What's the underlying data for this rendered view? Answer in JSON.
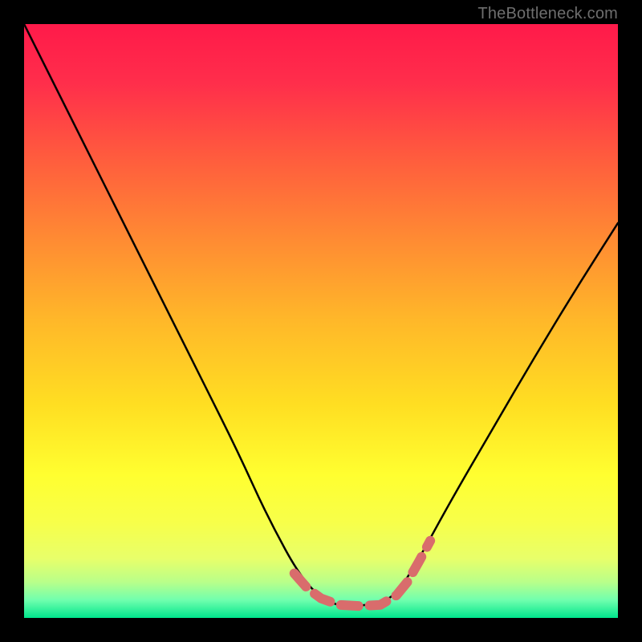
{
  "attribution": "TheBottleneck.com",
  "colors": {
    "frame": "#000000",
    "curve": "#000000",
    "rope": "#d96c6c",
    "gradient_stops": [
      {
        "offset": 0.0,
        "color": "#ff1a4a"
      },
      {
        "offset": 0.1,
        "color": "#ff2e4b"
      },
      {
        "offset": 0.22,
        "color": "#ff5a3e"
      },
      {
        "offset": 0.36,
        "color": "#ff8a33"
      },
      {
        "offset": 0.5,
        "color": "#ffb829"
      },
      {
        "offset": 0.64,
        "color": "#ffde22"
      },
      {
        "offset": 0.76,
        "color": "#ffff30"
      },
      {
        "offset": 0.84,
        "color": "#f7ff4a"
      },
      {
        "offset": 0.9,
        "color": "#e8ff6a"
      },
      {
        "offset": 0.94,
        "color": "#b8ff8a"
      },
      {
        "offset": 0.97,
        "color": "#70ffae"
      },
      {
        "offset": 1.0,
        "color": "#00e58c"
      }
    ]
  },
  "chart_data": {
    "type": "line",
    "title": "",
    "xlabel": "",
    "ylabel": "",
    "xlim": [
      0,
      1
    ],
    "ylim": [
      0,
      1
    ],
    "series": [
      {
        "name": "bottleneck-curve",
        "x": [
          0.0,
          0.06,
          0.12,
          0.18,
          0.24,
          0.3,
          0.36,
          0.41,
          0.47,
          0.52,
          0.57,
          0.62,
          0.66,
          0.72,
          0.79,
          0.86,
          0.93,
          1.0
        ],
        "y": [
          1.0,
          0.88,
          0.76,
          0.64,
          0.52,
          0.4,
          0.28,
          0.17,
          0.06,
          0.02,
          0.02,
          0.03,
          0.09,
          0.2,
          0.32,
          0.44,
          0.555,
          0.665
        ]
      }
    ],
    "annotations": [
      {
        "name": "dashed-rope-segment",
        "type": "polyline-dashed",
        "points": [
          {
            "x": 0.455,
            "y": 0.075
          },
          {
            "x": 0.478,
            "y": 0.049
          },
          {
            "x": 0.5,
            "y": 0.033
          },
          {
            "x": 0.53,
            "y": 0.022
          },
          {
            "x": 0.565,
            "y": 0.02
          },
          {
            "x": 0.6,
            "y": 0.022
          },
          {
            "x": 0.627,
            "y": 0.038
          },
          {
            "x": 0.645,
            "y": 0.06
          },
          {
            "x": 0.665,
            "y": 0.095
          },
          {
            "x": 0.684,
            "y": 0.13
          }
        ]
      }
    ]
  }
}
